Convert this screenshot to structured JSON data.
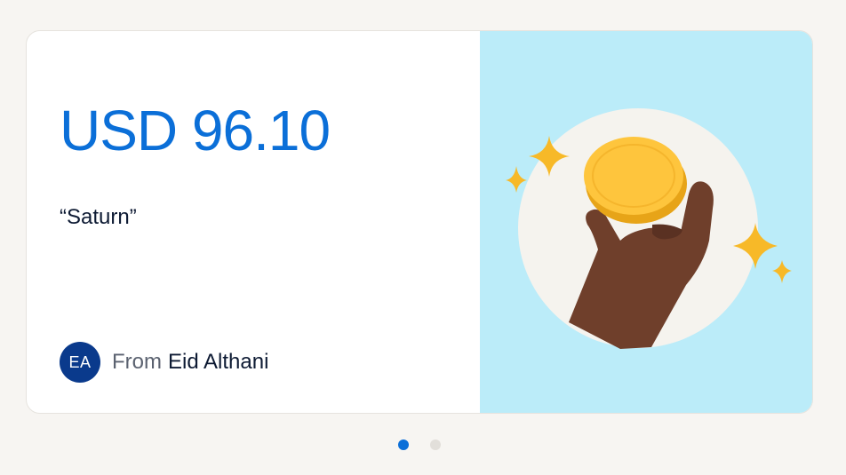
{
  "gift_card": {
    "amount": "USD 96.10",
    "message": "“Saturn”",
    "avatar_initials": "EA",
    "from_label": "From",
    "sender_name": "Eid Althani",
    "illustration_icon": "hand-holding-coin-icon"
  },
  "pager": {
    "total": 2,
    "active_index": 0
  },
  "colors": {
    "amount": "#0b6fd8",
    "avatar_bg": "#0a3a8c",
    "illustration_bg": "#bbecf9",
    "dot_active": "#0b6fd8",
    "dot_inactive": "#e2dfda"
  }
}
